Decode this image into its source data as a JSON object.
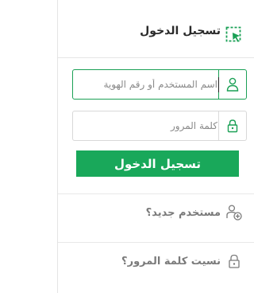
{
  "header": {
    "title": "تسجيل الدخول",
    "icon": "login-cursor-icon"
  },
  "username_field": {
    "placeholder": "اسم المستخدم أو رقم الهوية",
    "value": "",
    "icon": "user-icon"
  },
  "password_field": {
    "placeholder": "كلمة المرور",
    "value": "",
    "icon": "lock-icon"
  },
  "submit": {
    "label": "تسجيل الدخول",
    "color": "#19a85a"
  },
  "links": {
    "new_user": {
      "label": "مستخدم جديد؟",
      "icon": "user-add-icon"
    },
    "forgot_password": {
      "label": "نسيت كلمة المرور؟",
      "icon": "lock-icon"
    }
  },
  "colors": {
    "accent": "#1aa055",
    "icon_green": "#1aa055",
    "muted_text": "#7a7a7a"
  }
}
